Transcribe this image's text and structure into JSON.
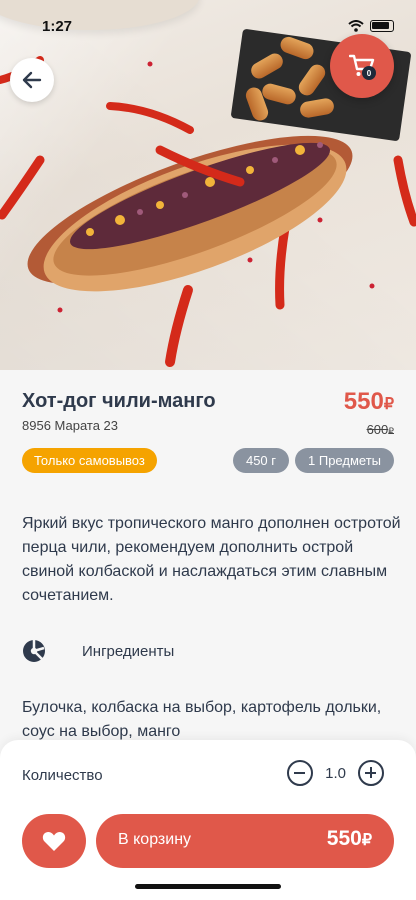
{
  "status_bar": {
    "time": "1:27"
  },
  "cart": {
    "count": "0"
  },
  "product": {
    "title": "Хот-дог чили-манго",
    "address": "8956 Марата 23",
    "price": "550",
    "currency": "₽",
    "old_price": "600",
    "pickup_badge": "Только самовывоз",
    "weight": "450 г",
    "items": "1 Предметы",
    "description": "Яркий вкус тропического манго дополнен остротой перца чили, рекомендуем дополнить острой свиной колбаской и наслаждаться этим славным сочетанием.",
    "ingredients_label": "Ингредиенты",
    "ingredients_text": "Булочка, колбаска на выбор, картофель дольки, соус на выбор, манго"
  },
  "bottom_bar": {
    "quantity_label": "Количество",
    "quantity_value": "1.0",
    "add_to_cart_label": "В корзину",
    "add_to_cart_price": "550"
  },
  "colors": {
    "accent": "#e0584a",
    "pickup": "#f5a300",
    "chip": "#8a93a0",
    "text": "#2f3a4c"
  },
  "icons": [
    "back-arrow-icon",
    "cart-icon",
    "heart-icon",
    "ingredients-icon",
    "minus-icon",
    "plus-icon",
    "wifi-icon",
    "battery-icon"
  ]
}
